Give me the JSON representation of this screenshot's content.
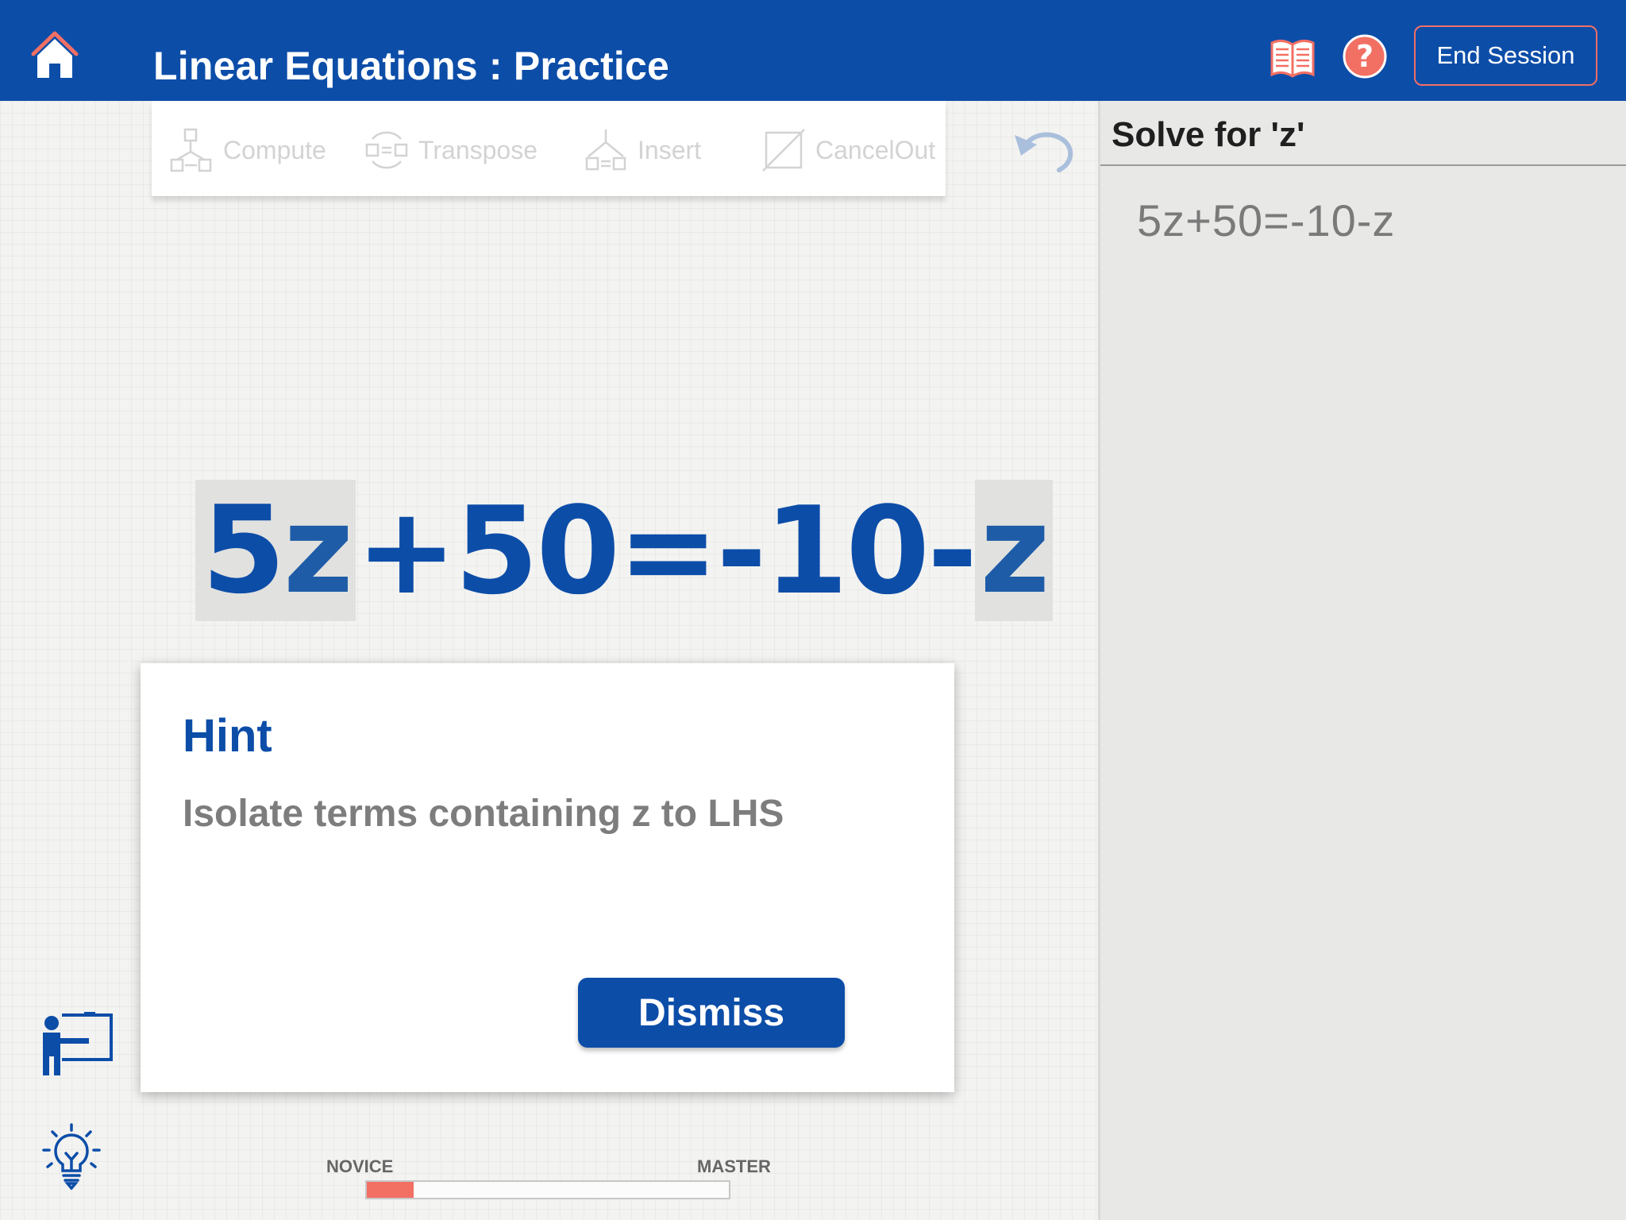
{
  "header": {
    "title": "Linear Equations : Practice",
    "end_session_label": "End Session"
  },
  "toolbar": {
    "items": [
      {
        "label": "Compute",
        "icon": "compute-icon"
      },
      {
        "label": "Transpose",
        "icon": "transpose-icon"
      },
      {
        "label": "Insert",
        "icon": "insert-icon"
      },
      {
        "label": "CancelOut",
        "icon": "cancelout-icon"
      }
    ]
  },
  "equation": {
    "terms": [
      "5",
      "z",
      "+50=-10-",
      "z"
    ]
  },
  "hint": {
    "title": "Hint",
    "text": "Isolate terms containing z to LHS",
    "dismiss_label": "Dismiss"
  },
  "progress": {
    "start_label": "NOVICE",
    "end_label": "MASTER",
    "value": 0.13
  },
  "panel": {
    "title": "Solve for 'z'",
    "steps": [
      "5z+50=-10-z"
    ]
  },
  "colors": {
    "primary": "#0c4da8",
    "accent": "#f26f64"
  }
}
